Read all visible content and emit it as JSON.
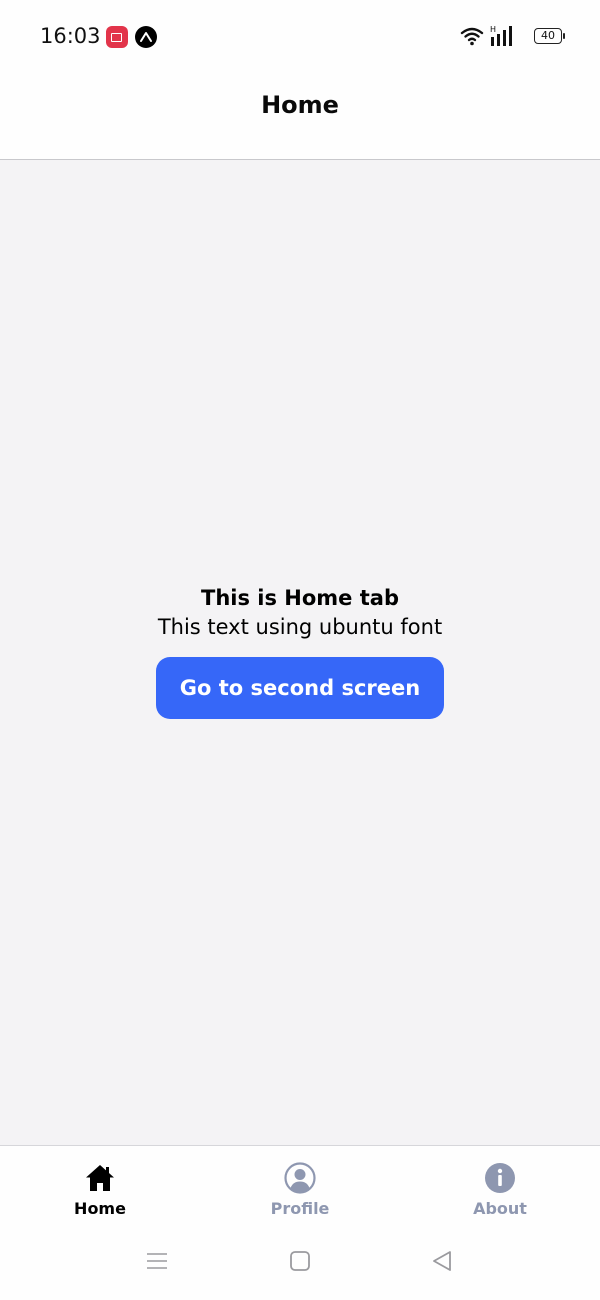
{
  "status_bar": {
    "time": "16:03",
    "battery_level": "40",
    "icons": [
      "screen-record-icon",
      "expo-icon",
      "wifi-icon",
      "signal-icon",
      "battery-icon"
    ]
  },
  "header": {
    "title": "Home"
  },
  "main": {
    "title": "This is Home tab",
    "subtitle": "This text using ubuntu font",
    "button_label": "Go to second screen"
  },
  "tabs": [
    {
      "label": "Home",
      "icon": "home-icon",
      "active": true
    },
    {
      "label": "Profile",
      "icon": "profile-icon",
      "active": false
    },
    {
      "label": "About",
      "icon": "info-icon",
      "active": false
    }
  ],
  "nav_bar": {
    "icons": [
      "menu-icon",
      "home-square-icon",
      "back-icon"
    ]
  },
  "colors": {
    "accent": "#3667f8",
    "active_tab": "#000000",
    "inactive_tab": "#8e97b0",
    "background": "#f4f3f5",
    "record_badge": "#e2344a"
  }
}
